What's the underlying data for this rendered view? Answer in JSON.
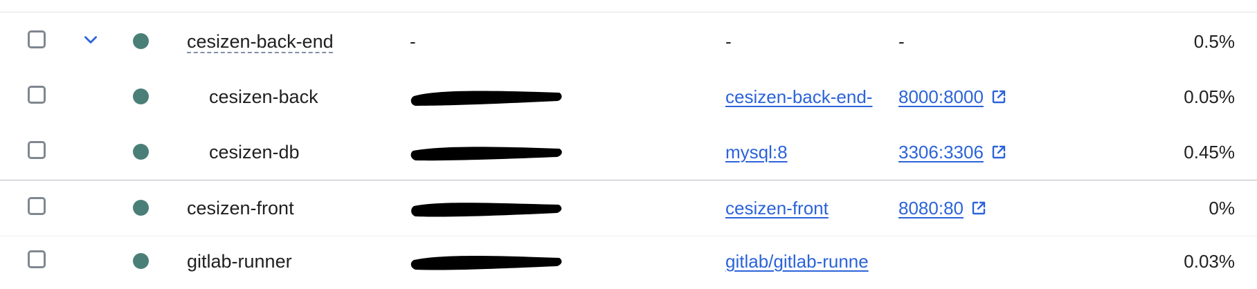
{
  "colors": {
    "status_running": "#4a7f77",
    "link": "#2b63d9",
    "chevron": "#2b63d9"
  },
  "rows": [
    {
      "name": "cesizen-back-end",
      "kind": "group",
      "expanded": true,
      "container_id": "-",
      "image": "-",
      "port": "-",
      "cpu": "0.5%"
    },
    {
      "name": "cesizen-back",
      "kind": "child",
      "container_id_redacted": true,
      "image": "cesizen-back-end-",
      "port": "8000:8000",
      "cpu": "0.05%"
    },
    {
      "name": "cesizen-db",
      "kind": "child",
      "container_id_redacted": true,
      "image": "mysql:8",
      "port": "3306:3306",
      "cpu": "0.45%"
    },
    {
      "name": "cesizen-front",
      "kind": "standalone",
      "container_id_redacted": true,
      "image": "cesizen-front",
      "port": "8080:80",
      "cpu": "0%"
    },
    {
      "name": "gitlab-runner",
      "kind": "standalone",
      "container_id_redacted": true,
      "image": "gitlab/gitlab-runne",
      "port": "",
      "cpu": "0.03%"
    }
  ],
  "icons": {
    "checkbox": "checkbox-icon",
    "status": "status-dot-icon",
    "expand": "chevron-down-icon",
    "open_port": "external-link-icon"
  }
}
